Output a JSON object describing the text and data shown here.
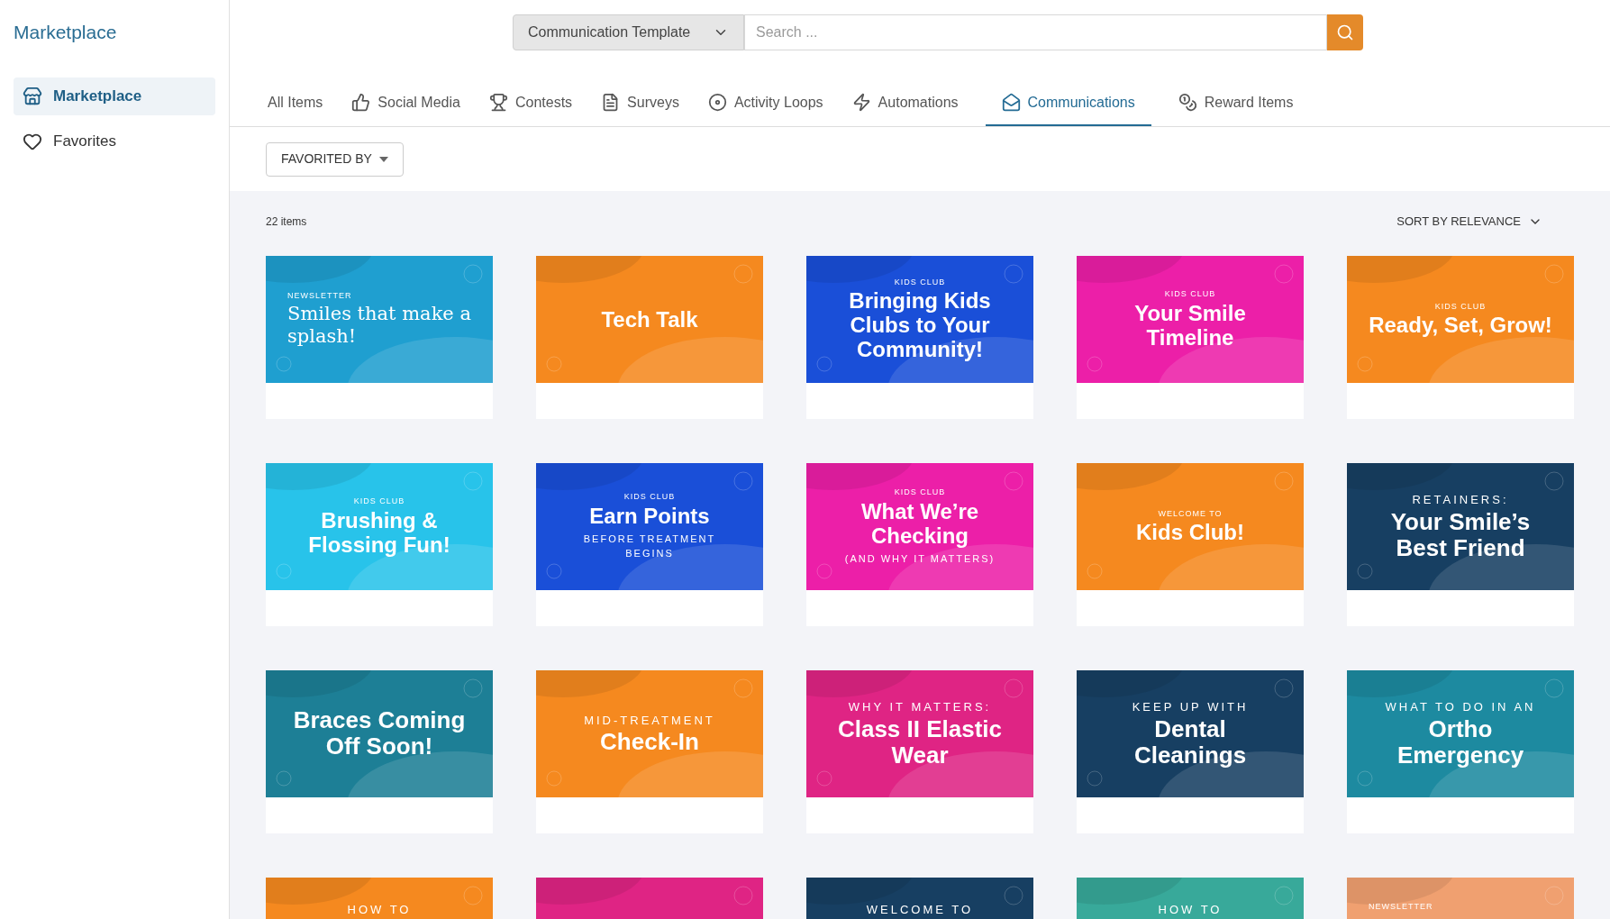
{
  "sidebar": {
    "title": "Marketplace",
    "items": [
      {
        "label": "Marketplace",
        "selected": true
      },
      {
        "label": "Favorites",
        "selected": false
      }
    ]
  },
  "search": {
    "category": "Communication Template",
    "placeholder": "Search ..."
  },
  "tabs": [
    {
      "label": "All Items",
      "selected": false
    },
    {
      "label": "Social Media",
      "selected": false
    },
    {
      "label": "Contests",
      "selected": false
    },
    {
      "label": "Surveys",
      "selected": false
    },
    {
      "label": "Activity Loops",
      "selected": false
    },
    {
      "label": "Automations",
      "selected": false
    },
    {
      "label": "Communications",
      "selected": true
    },
    {
      "label": "Reward Items",
      "selected": false
    }
  ],
  "filter": {
    "label": "FAVORITED BY"
  },
  "count": "22 items",
  "sort": {
    "label": "SORT BY RELEVANCE"
  },
  "cards": [
    {
      "kicker": "NEWSLETTER",
      "title": "Smiles that make a splash!",
      "color": "#1f9fd0"
    },
    {
      "title": "Tech Talk",
      "color": "#f5891f"
    },
    {
      "kicker": "KIDS CLUB",
      "title": "Bringing Kids Clubs to Your Community!",
      "color": "#1a4fd8"
    },
    {
      "kicker": "KIDS CLUB",
      "title": "Your Smile Timeline",
      "color": "#ec1fa8"
    },
    {
      "kicker": "KIDS CLUB",
      "title": "Ready, Set, Grow!",
      "color": "#f5891f"
    },
    {
      "kicker": "KIDS CLUB",
      "title": "Brushing & Flossing Fun!",
      "color": "#28c3ea"
    },
    {
      "kicker": "KIDS CLUB",
      "title": "Earn Points",
      "subtitle": "BEFORE TREATMENT BEGINS",
      "color": "#1a4fd8"
    },
    {
      "kicker": "KIDS CLUB",
      "title": "What We’re Checking",
      "subtitle": "(AND WHY IT MATTERS)",
      "color": "#ec1fa8"
    },
    {
      "kicker": "WELCOME TO",
      "title": "Kids Club!",
      "color": "#f5891f"
    },
    {
      "kicker": "RETAINERS:",
      "title": "Your Smile’s Best Friend",
      "color": "#173f62"
    },
    {
      "title": "Braces Coming Off Soon!",
      "color": "#1d7f96"
    },
    {
      "kicker": "MID-TREATMENT",
      "title": "Check-In",
      "color": "#f5891f"
    },
    {
      "kicker": "WHY IT MATTERS:",
      "title": "Class II Elastic Wear",
      "color": "#df2484"
    },
    {
      "kicker": "KEEP UP WITH",
      "title": "Dental Cleanings",
      "color": "#173f62"
    },
    {
      "kicker": "WHAT TO DO IN AN",
      "title": "Ortho Emergency",
      "color": "#1d8aa0"
    },
    {
      "kicker": "HOW TO",
      "color": "#f5891f"
    },
    {
      "color": "#df2484"
    },
    {
      "kicker": "WELCOME TO",
      "color": "#173f62"
    },
    {
      "kicker": "HOW TO",
      "color": "#38a99a"
    },
    {
      "kicker": "NEWSLETTER",
      "color": "#f0a070"
    }
  ]
}
